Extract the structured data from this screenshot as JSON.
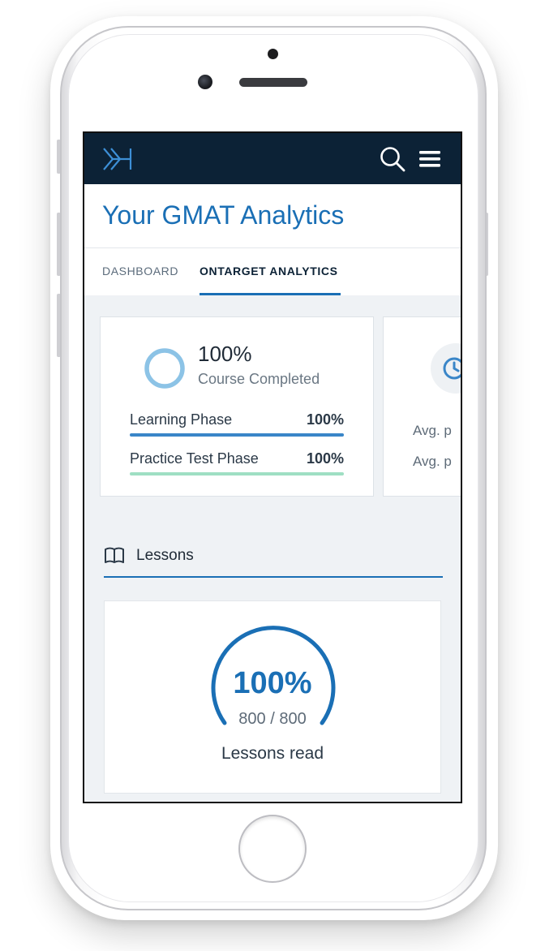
{
  "app": {
    "title": "Your GMAT Analytics",
    "colors": {
      "header_bg": "#0c2236",
      "accent": "#1a6fb5",
      "learning_bar": "#3a86c8",
      "practice_bar": "#9fdfc3"
    },
    "icons": {
      "logo": "logo-icon",
      "search": "search-icon",
      "menu": "hamburger-menu-icon",
      "lessons": "book-icon",
      "time": "clock-icon"
    }
  },
  "tabs": [
    {
      "label": "DASHBOARD",
      "active": false
    },
    {
      "label": "ONTARGET ANALYTICS",
      "active": true
    }
  ],
  "summary": {
    "percent": "100%",
    "label": "Course Completed",
    "progress": 1.0,
    "phases": [
      {
        "label": "Learning Phase",
        "value": "100%",
        "progress": 1.0
      },
      {
        "label": "Practice Test Phase",
        "value": "100%",
        "progress": 1.0
      }
    ]
  },
  "second_card": {
    "rows": [
      "Avg. p",
      "Avg. p"
    ]
  },
  "lessons": {
    "title": "Lessons",
    "percent": "100%",
    "count": "800 / 800",
    "caption": "Lessons read",
    "progress": 1.0
  }
}
